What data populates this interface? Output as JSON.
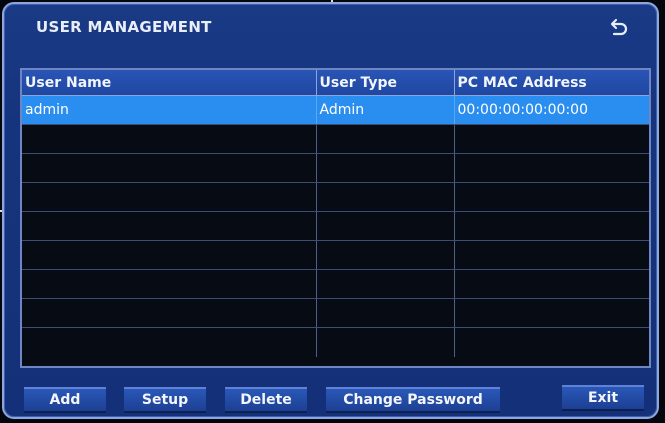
{
  "dialog": {
    "title": "USER MANAGEMENT",
    "back_icon": "undo-arrow-icon"
  },
  "table": {
    "columns": [
      "User Name",
      "User Type",
      "PC MAC Address"
    ],
    "rows": [
      [
        "admin",
        "Admin",
        "00:00:00:00:00:00"
      ],
      [
        "",
        "",
        ""
      ],
      [
        "",
        "",
        ""
      ],
      [
        "",
        "",
        ""
      ],
      [
        "",
        "",
        ""
      ],
      [
        "",
        "",
        ""
      ],
      [
        "",
        "",
        ""
      ],
      [
        "",
        "",
        ""
      ],
      [
        "",
        "",
        ""
      ]
    ],
    "selected_row": 0
  },
  "buttons": {
    "add": "Add",
    "setup": "Setup",
    "delete": "Delete",
    "change_password": "Change Password",
    "exit": "Exit"
  },
  "colors": {
    "panel": "#16347d",
    "header": "#2a55b5",
    "selected": "#2a8ef0",
    "grid_background": "#070b13"
  }
}
